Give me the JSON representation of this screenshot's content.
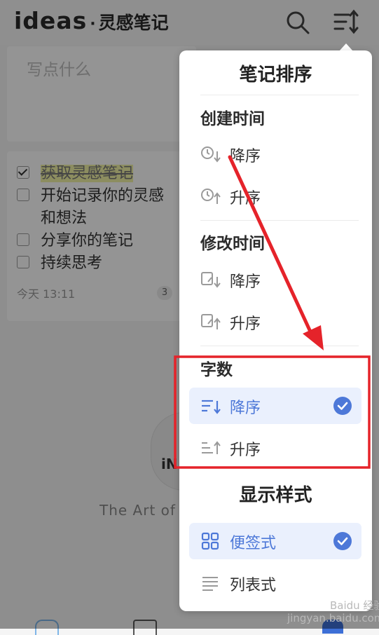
{
  "app": {
    "brand_main": "ideas",
    "brand_dot": "·",
    "brand_sub": "灵感笔记"
  },
  "compose": {
    "placeholder": "写点什么"
  },
  "note": {
    "todos": [
      {
        "text": "获取灵感笔记",
        "checked": true
      },
      {
        "text": "开始记录你的灵感和想法",
        "checked": false
      },
      {
        "text": "分享你的笔记",
        "checked": false
      },
      {
        "text": "持续思考",
        "checked": false
      }
    ],
    "date": "今天 13:11",
    "count": "3"
  },
  "empty_state": {
    "logo_text": "iN",
    "caption": "The Art of C"
  },
  "sort_menu": {
    "title": "笔记排序",
    "groups": [
      {
        "label": "创建时间",
        "options": [
          {
            "label": "降序",
            "icon": "clock-down-icon",
            "selected": false
          },
          {
            "label": "升序",
            "icon": "clock-up-icon",
            "selected": false
          }
        ]
      },
      {
        "label": "修改时间",
        "options": [
          {
            "label": "降序",
            "icon": "edit-down-icon",
            "selected": false
          },
          {
            "label": "升序",
            "icon": "edit-up-icon",
            "selected": false
          }
        ]
      },
      {
        "label": "字数",
        "options": [
          {
            "label": "降序",
            "icon": "lines-down-icon",
            "selected": true
          },
          {
            "label": "升序",
            "icon": "lines-up-icon",
            "selected": false
          }
        ]
      }
    ]
  },
  "display_menu": {
    "title": "显示样式",
    "options": [
      {
        "label": "便签式",
        "icon": "grid-icon",
        "selected": true
      },
      {
        "label": "列表式",
        "icon": "list-icon",
        "selected": false
      }
    ]
  },
  "colors": {
    "accent": "#4d78d8",
    "selected_bg": "#eaf0fd",
    "annotation_red": "#e5232a"
  },
  "watermark": {
    "line1": "Baidu 经验",
    "line2": "jingyan.baidu.com"
  }
}
